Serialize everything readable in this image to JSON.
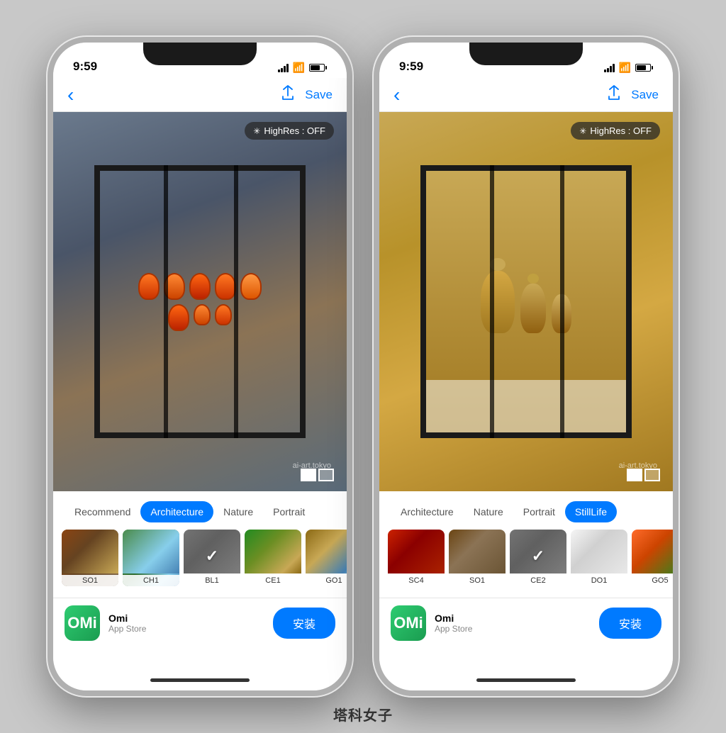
{
  "scene": {
    "background": "#c8c8c8",
    "watermark": "塔科女子"
  },
  "phones": [
    {
      "id": "phone-left",
      "status": {
        "time": "9:59",
        "signal": true,
        "wifi": true,
        "battery": true
      },
      "nav": {
        "back_label": "‹",
        "share_label": "⬆",
        "save_label": "Save"
      },
      "painting": {
        "type": "left",
        "highres_label": "HighRes : OFF",
        "watermark": "ai-art.tokyo"
      },
      "tabs": [
        {
          "id": "recommend",
          "label": "Recommend",
          "active": false
        },
        {
          "id": "architecture",
          "label": "Architecture",
          "active": true
        },
        {
          "id": "nature",
          "label": "Nature",
          "active": false
        },
        {
          "id": "portrait",
          "label": "Portrait",
          "active": false
        }
      ],
      "swatches": [
        {
          "id": "so1",
          "label": "SO1",
          "selected": false,
          "class": "swatch-so1"
        },
        {
          "id": "ch1",
          "label": "CH1",
          "selected": false,
          "class": "swatch-ch1"
        },
        {
          "id": "bl1",
          "label": "BL1",
          "selected": true,
          "class": "swatch-bl1"
        },
        {
          "id": "ce1",
          "label": "CE1",
          "selected": false,
          "class": "swatch-ce1"
        },
        {
          "id": "go1",
          "label": "GO1",
          "selected": false,
          "class": "swatch-go1"
        }
      ],
      "ad": {
        "icon_text": "OMi",
        "title": "Omi",
        "subtitle": "App Store",
        "install_label": "安装"
      }
    },
    {
      "id": "phone-right",
      "status": {
        "time": "9:59",
        "signal": true,
        "wifi": true,
        "battery": true
      },
      "nav": {
        "back_label": "‹",
        "share_label": "⬆",
        "save_label": "Save"
      },
      "painting": {
        "type": "right",
        "highres_label": "HighRes : OFF",
        "watermark": "ai-art.tokyo"
      },
      "tabs": [
        {
          "id": "architecture",
          "label": "Architecture",
          "active": false
        },
        {
          "id": "nature",
          "label": "Nature",
          "active": false
        },
        {
          "id": "portrait",
          "label": "Portrait",
          "active": false
        },
        {
          "id": "stilllife",
          "label": "StillLife",
          "active": true
        }
      ],
      "swatches": [
        {
          "id": "sc4",
          "label": "SC4",
          "selected": false,
          "class": "swatch-sc4"
        },
        {
          "id": "so1",
          "label": "SO1",
          "selected": false,
          "class": "swatch-so1r"
        },
        {
          "id": "ce2",
          "label": "CE2",
          "selected": true,
          "class": "swatch-ce2"
        },
        {
          "id": "do1",
          "label": "DO1",
          "selected": false,
          "class": "swatch-do1"
        },
        {
          "id": "go5",
          "label": "GO5",
          "selected": false,
          "class": "swatch-go5"
        },
        {
          "id": "extra",
          "label": "...",
          "selected": false,
          "class": "swatch-extra"
        }
      ],
      "ad": {
        "icon_text": "OMi",
        "title": "Omi",
        "subtitle": "App Store",
        "install_label": "安装"
      }
    }
  ]
}
